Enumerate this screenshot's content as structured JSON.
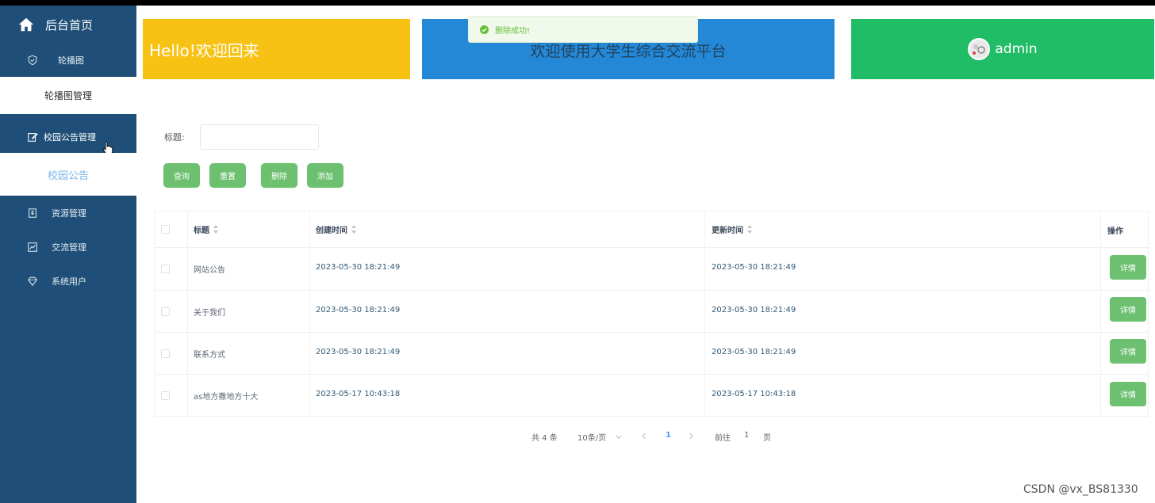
{
  "sidebar": {
    "home_label": "后台首页",
    "items": [
      {
        "label": "轮播图"
      },
      {
        "label": "轮播图管理"
      },
      {
        "label": "校园公告管理"
      },
      {
        "label": "校园公告"
      },
      {
        "label": "资源管理"
      },
      {
        "label": "交流管理"
      },
      {
        "label": "系统用户"
      }
    ]
  },
  "cards": {
    "welcome": "Hello!欢迎回来",
    "platform": "欢迎使用大学生综合交流平台",
    "user": "admin"
  },
  "toast": {
    "message": "删除成功!"
  },
  "search": {
    "title_label": "标题:",
    "title_value": ""
  },
  "buttons": {
    "query": "查询",
    "reset": "重置",
    "delete": "删除",
    "add": "添加"
  },
  "table": {
    "headers": {
      "title": "标题",
      "created": "创建时间",
      "updated": "更新时间",
      "actions": "操作"
    },
    "rows": [
      {
        "title": "网站公告",
        "created": "2023-05-30 18:21:49",
        "updated": "2023-05-30 18:21:49",
        "action": "详情"
      },
      {
        "title": "关于我们",
        "created": "2023-05-30 18:21:49",
        "updated": "2023-05-30 18:21:49",
        "action": "详情"
      },
      {
        "title": "联系方式",
        "created": "2023-05-30 18:21:49",
        "updated": "2023-05-30 18:21:49",
        "action": "详情"
      },
      {
        "title": "as地方撒地方十大",
        "created": "2023-05-17 10:43:18",
        "updated": "2023-05-17 10:43:18",
        "action": "详情"
      }
    ]
  },
  "pagination": {
    "total": "共 4 条",
    "page_size": "10条/页",
    "current_page": "1",
    "goto_label": "前往",
    "goto_value": "1",
    "page_suffix": "页"
  },
  "watermark": "CSDN @vx_BS81330",
  "colors": {
    "sidebar": "#1f4f78",
    "welcome_card": "#f8c214",
    "platform_card": "#2488d6",
    "user_card": "#21bc66",
    "button": "#6cc06f"
  }
}
